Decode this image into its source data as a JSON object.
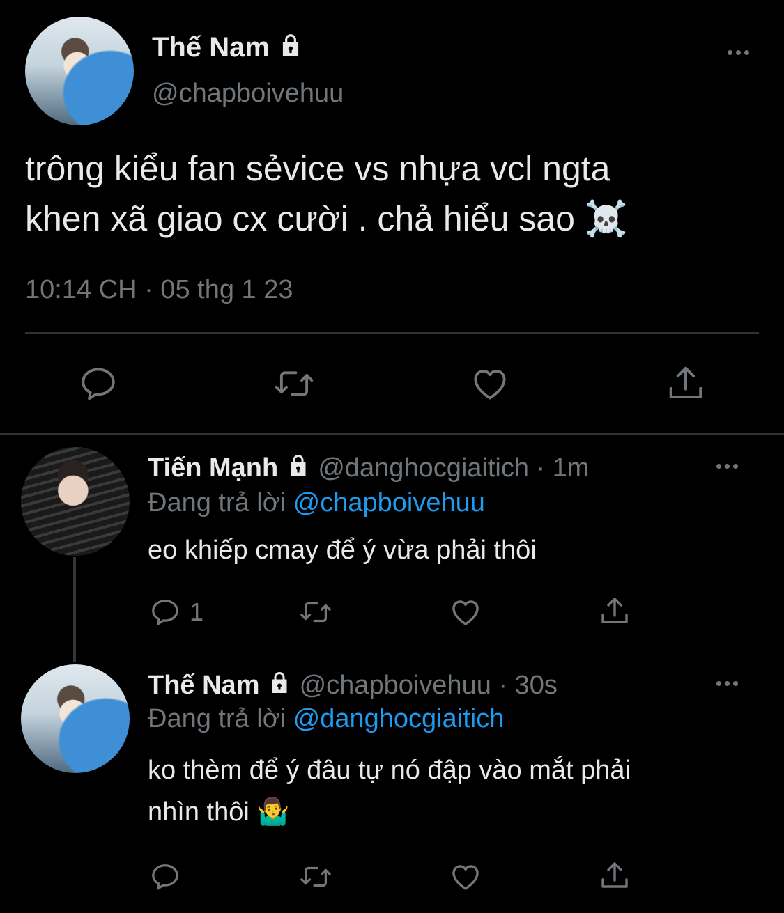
{
  "main_tweet": {
    "display_name": "Thế Nam",
    "handle": "@chapboivehuu",
    "text_line1": "trông kiểu fan sẻvice vs nhựa vcl ngta",
    "text_line2": "khen xã giao cx cười . chả hiểu sao ☠️",
    "timestamp": "10:14 CH · 05 thg 1 23"
  },
  "replies": [
    {
      "display_name": "Tiến Mạnh",
      "handle_time": "@danghocgiaitich · 1m",
      "replying_prefix": "Đang trả lời",
      "replying_to": "@chapboivehuu",
      "text_line1": "eo khiếp cmay để ý vừa phải thôi",
      "reply_count": "1"
    },
    {
      "display_name": "Thế Nam",
      "handle_time": "@chapboivehuu · 30s",
      "replying_prefix": "Đang trả lời",
      "replying_to": "@danghocgiaitich",
      "text_line1": "ko thèm để ý đâu tự nó đập vào mắt phải",
      "text_line2": "nhìn thôi 🤷‍♂️"
    }
  ],
  "icons": {
    "lock": "lock-icon",
    "more": "more-icon",
    "reply": "reply-icon",
    "retweet": "retweet-icon",
    "like": "like-icon",
    "share": "share-icon"
  },
  "colors": {
    "background": "#000000",
    "text": "#e7e9ea",
    "muted": "#71767b",
    "link": "#1d9bf0",
    "divider": "#2f3336"
  }
}
